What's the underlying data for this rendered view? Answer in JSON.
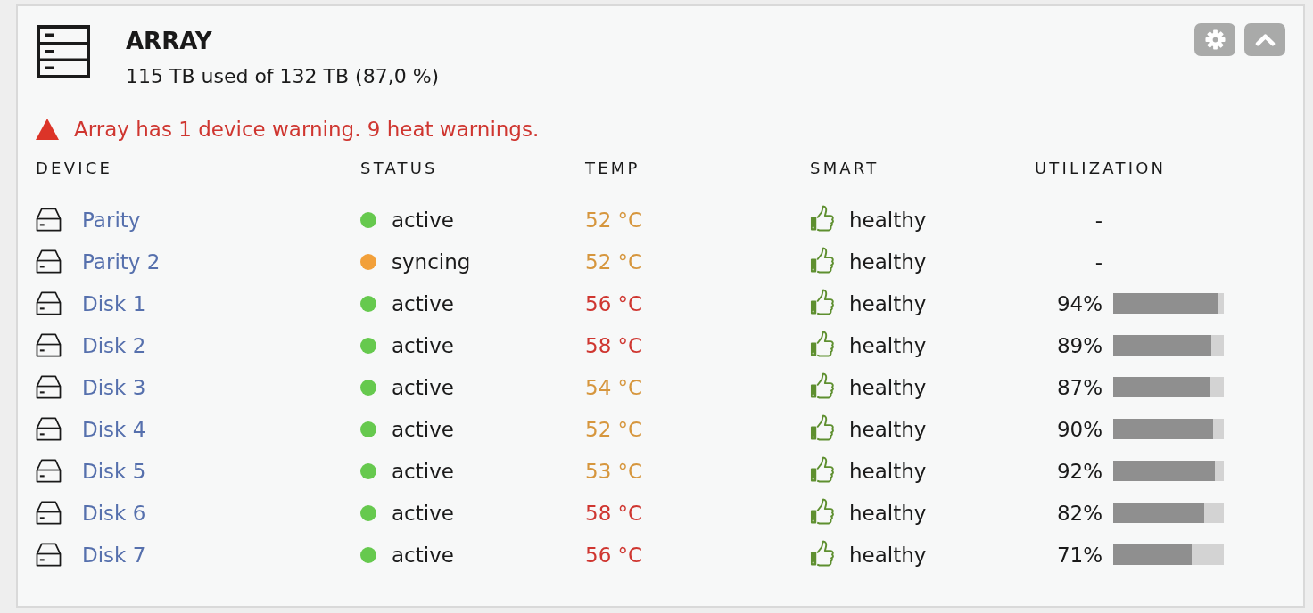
{
  "panel": {
    "title": "ARRAY",
    "usage": "115 TB used of 132 TB (87,0 %)",
    "buttons": [
      {
        "kind": "settings"
      },
      {
        "kind": "collapse"
      }
    ]
  },
  "warning": {
    "text": "Array has 1 device warning. 9 heat warnings."
  },
  "table": {
    "columns": [
      "DEVICE",
      "STATUS",
      "TEMP",
      "SMART",
      "UTILIZATION"
    ],
    "rows": [
      {
        "device": "Parity",
        "status": {
          "text": "active",
          "color": "#66c94e"
        },
        "temp": {
          "text": "52 °C",
          "color": "#d6963d"
        },
        "smart": "healthy",
        "utilization": {
          "text": "-"
        }
      },
      {
        "device": "Parity 2",
        "status": {
          "text": "syncing",
          "color": "#f2a03a"
        },
        "temp": {
          "text": "52 °C",
          "color": "#d6963d"
        },
        "smart": "healthy",
        "utilization": {
          "text": "-"
        }
      },
      {
        "device": "Disk 1",
        "status": {
          "text": "active",
          "color": "#66c94e"
        },
        "temp": {
          "text": "56 °C",
          "color": "#cf3630"
        },
        "smart": "healthy",
        "utilization": {
          "text": "94%",
          "level": 0.94
        }
      },
      {
        "device": "Disk 2",
        "status": {
          "text": "active",
          "color": "#66c94e"
        },
        "temp": {
          "text": "58 °C",
          "color": "#cf3630"
        },
        "smart": "healthy",
        "utilization": {
          "text": "89%",
          "level": 0.89
        }
      },
      {
        "device": "Disk 3",
        "status": {
          "text": "active",
          "color": "#66c94e"
        },
        "temp": {
          "text": "54 °C",
          "color": "#d6963d"
        },
        "smart": "healthy",
        "utilization": {
          "text": "87%",
          "level": 0.87
        }
      },
      {
        "device": "Disk 4",
        "status": {
          "text": "active",
          "color": "#66c94e"
        },
        "temp": {
          "text": "52 °C",
          "color": "#d6963d"
        },
        "smart": "healthy",
        "utilization": {
          "text": "90%",
          "level": 0.9
        }
      },
      {
        "device": "Disk 5",
        "status": {
          "text": "active",
          "color": "#66c94e"
        },
        "temp": {
          "text": "53 °C",
          "color": "#d6963d"
        },
        "smart": "healthy",
        "utilization": {
          "text": "92%",
          "level": 0.92
        }
      },
      {
        "device": "Disk 6",
        "status": {
          "text": "active",
          "color": "#66c94e"
        },
        "temp": {
          "text": "58 °C",
          "color": "#cf3630"
        },
        "smart": "healthy",
        "utilization": {
          "text": "82%",
          "level": 0.82
        }
      },
      {
        "device": "Disk 7",
        "status": {
          "text": "active",
          "color": "#66c94e"
        },
        "temp": {
          "text": "56 °C",
          "color": "#cf3630"
        },
        "smart": "healthy",
        "utilization": {
          "text": "71%",
          "level": 0.71
        }
      }
    ]
  }
}
